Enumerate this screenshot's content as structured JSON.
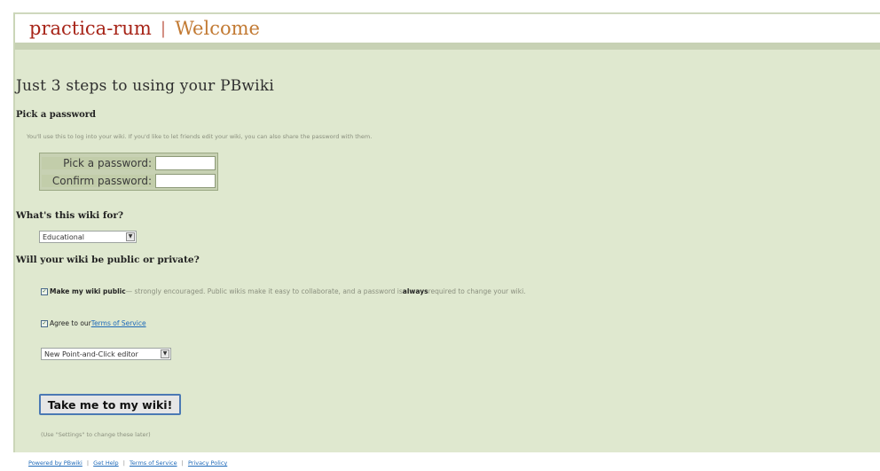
{
  "header": {
    "site_name": "practica-rum",
    "separator": "|",
    "welcome": "Welcome"
  },
  "main": {
    "title": "Just 3 steps to using your PBwiki",
    "password_section": {
      "label": "Pick a password",
      "hint": "You'll use this to log into your wiki. If you'd like to let friends edit your wiki, you can also share the password with them.",
      "pick_label": "Pick a password:",
      "confirm_label": "Confirm password:",
      "pick_value": "",
      "confirm_value": ""
    },
    "purpose_section": {
      "label": "What's this wiki for?",
      "selected": "Educational"
    },
    "privacy_section": {
      "label": "Will your wiki be public or private?",
      "public_checkbox": {
        "checked": true,
        "label_bold": "Make my wiki public",
        "label_rest": " — strongly encouraged. Public wikis make it easy to collaborate, and a password is ",
        "always": "always",
        "label_end": " required to change your wiki."
      },
      "tos_checkbox": {
        "checked": true,
        "label": "Agree to our ",
        "link": "Terms of Service"
      },
      "editor_selected": "New Point-and-Click editor"
    },
    "submit_label": "Take me to my wiki!",
    "settings_note": "(Use \"Settings\" to change these later)"
  },
  "footer": {
    "powered": "Powered by PBwiki",
    "get_help": "Get Help",
    "terms": "Terms of Service",
    "privacy": "Privacy Policy",
    "separator": "|"
  },
  "colors": {
    "brand": "#a72418",
    "welcome": "#c27a33",
    "panel_bg": "#dfe8cf",
    "header_stripe": "#c7d1b4",
    "button_border": "#4b79b4"
  }
}
